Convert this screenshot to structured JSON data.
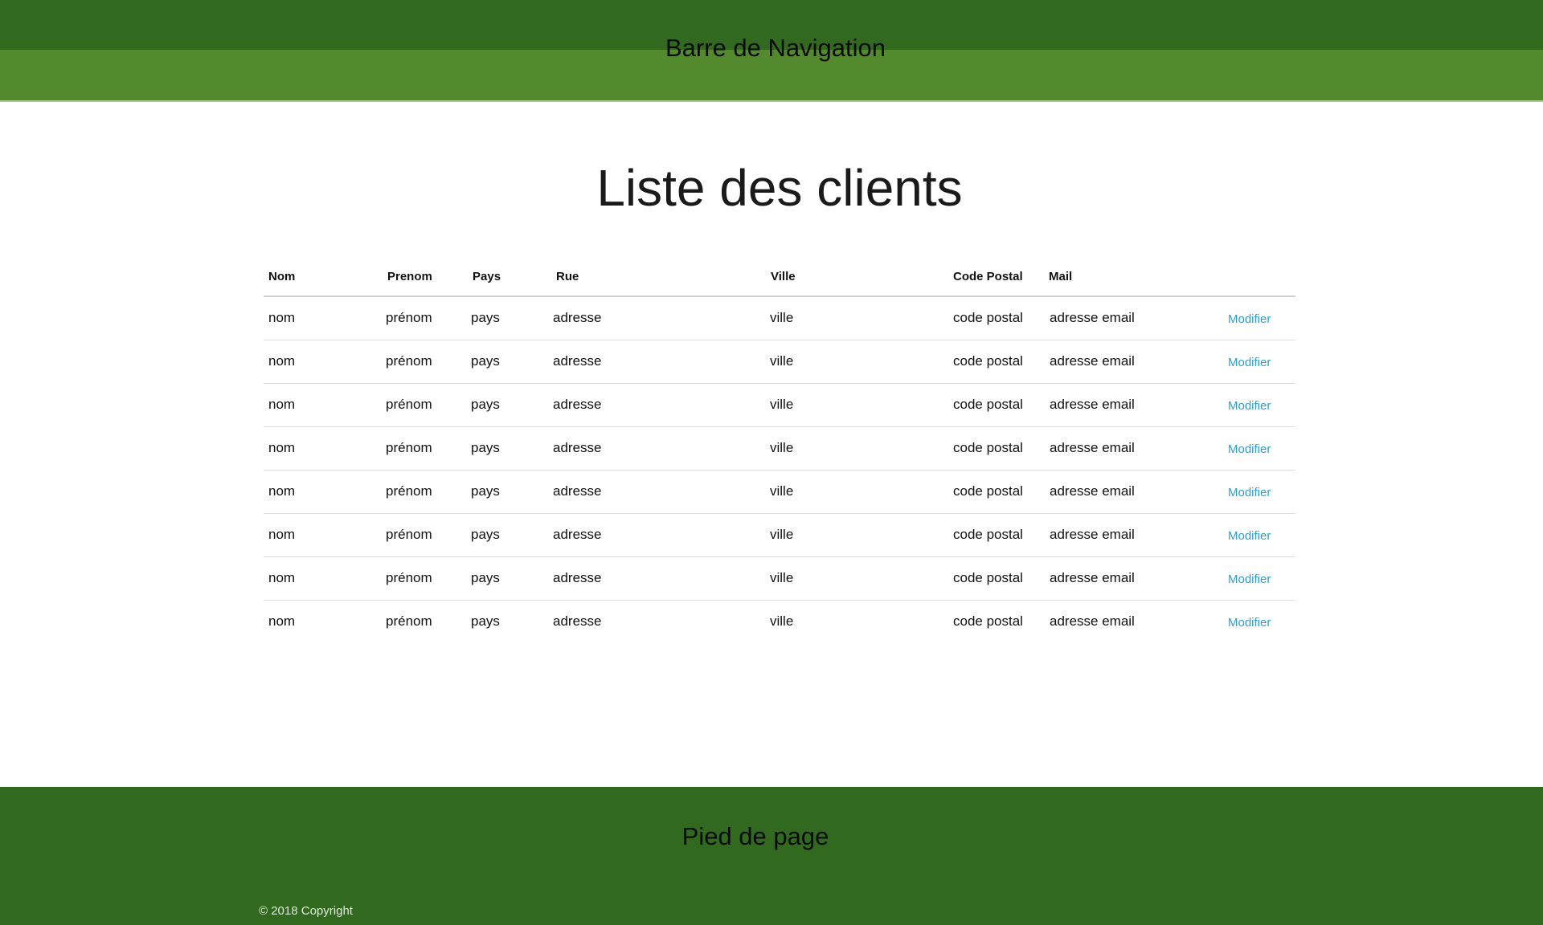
{
  "navbar": {
    "title": "Barre de Navigation"
  },
  "main": {
    "title": "Liste des clients"
  },
  "table": {
    "headers": {
      "nom": "Nom",
      "prenom": "Prenom",
      "pays": "Pays",
      "rue": "Rue",
      "ville": "Ville",
      "cp": "Code Postal",
      "mail": "Mail"
    },
    "rows": [
      {
        "nom": "nom",
        "prenom": "prénom",
        "pays": "pays",
        "rue": "adresse",
        "ville": "ville",
        "cp": "code postal",
        "mail": "adresse email",
        "action": "Modifier"
      },
      {
        "nom": "nom",
        "prenom": "prénom",
        "pays": "pays",
        "rue": "adresse",
        "ville": "ville",
        "cp": "code postal",
        "mail": "adresse email",
        "action": "Modifier"
      },
      {
        "nom": "nom",
        "prenom": "prénom",
        "pays": "pays",
        "rue": "adresse",
        "ville": "ville",
        "cp": "code postal",
        "mail": "adresse email",
        "action": "Modifier"
      },
      {
        "nom": "nom",
        "prenom": "prénom",
        "pays": "pays",
        "rue": "adresse",
        "ville": "ville",
        "cp": "code postal",
        "mail": "adresse email",
        "action": "Modifier"
      },
      {
        "nom": "nom",
        "prenom": "prénom",
        "pays": "pays",
        "rue": "adresse",
        "ville": "ville",
        "cp": "code postal",
        "mail": "adresse email",
        "action": "Modifier"
      },
      {
        "nom": "nom",
        "prenom": "prénom",
        "pays": "pays",
        "rue": "adresse",
        "ville": "ville",
        "cp": "code postal",
        "mail": "adresse email",
        "action": "Modifier"
      },
      {
        "nom": "nom",
        "prenom": "prénom",
        "pays": "pays",
        "rue": "adresse",
        "ville": "ville",
        "cp": "code postal",
        "mail": "adresse email",
        "action": "Modifier"
      },
      {
        "nom": "nom",
        "prenom": "prénom",
        "pays": "pays",
        "rue": "adresse",
        "ville": "ville",
        "cp": "code postal",
        "mail": "adresse email",
        "action": "Modifier"
      }
    ]
  },
  "footer": {
    "title": "Pied de page",
    "copyright": "© 2018 Copyright"
  },
  "colors": {
    "nav_dark": "#316a1f",
    "nav_light": "#538a2e",
    "link": "#2a9fd6"
  }
}
